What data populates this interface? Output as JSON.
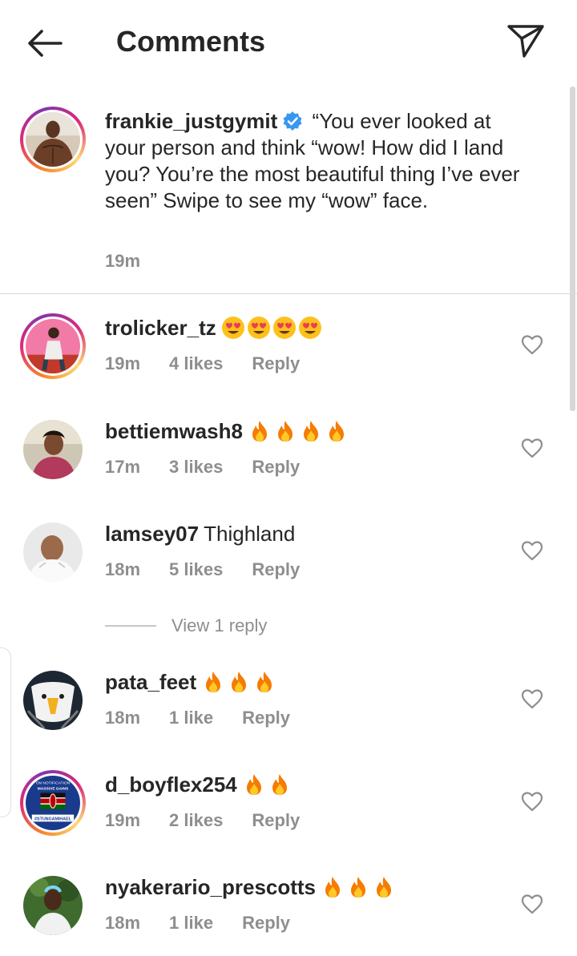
{
  "header": {
    "title": "Comments",
    "back_icon": "arrow-left-icon",
    "send_icon": "paper-plane-icon"
  },
  "caption": {
    "username": "frankie_justgymit",
    "verified": true,
    "text": "“You ever looked at your person and think “wow! How did I land you? You’re the most beautiful thing I’ve ever seen” Swipe to see my “wow” face.",
    "time": "19m"
  },
  "comments": [
    {
      "username": "trolicker_tz",
      "text": "",
      "emoji": "heart-eyes",
      "emoji_count": 4,
      "time": "19m",
      "likes": "4 likes",
      "reply": "Reply",
      "story_ring": true
    },
    {
      "username": "bettiemwash8",
      "text": "",
      "emoji": "fire",
      "emoji_count": 4,
      "time": "17m",
      "likes": "3 likes",
      "reply": "Reply",
      "story_ring": false
    },
    {
      "username": "lamsey07",
      "text": "Thighland",
      "emoji": "",
      "emoji_count": 0,
      "time": "18m",
      "likes": "5 likes",
      "reply": "Reply",
      "story_ring": false
    },
    {
      "username": "pata_feet",
      "text": "",
      "emoji": "fire",
      "emoji_count": 3,
      "time": "18m",
      "likes": "1 like",
      "reply": "Reply",
      "story_ring": false
    },
    {
      "username": "d_boyflex254",
      "text": "",
      "emoji": "fire",
      "emoji_count": 2,
      "time": "19m",
      "likes": "2 likes",
      "reply": "Reply",
      "story_ring": true
    },
    {
      "username": "nyakerario_prescotts",
      "text": "",
      "emoji": "fire",
      "emoji_count": 3,
      "time": "18m",
      "likes": "1 like",
      "reply": "Reply",
      "story_ring": false
    }
  ],
  "view_replies": "View 1 reply",
  "avatar_badge": {
    "line1": "ON NOTIFICATION",
    "line2": "MASSIVE GAINS",
    "line3": "#STUNGAMIHAEL"
  },
  "colors": {
    "text": "#262626",
    "secondary": "#8e8e8e",
    "verified": "#3897f0",
    "divider": "#dbdbdb"
  }
}
